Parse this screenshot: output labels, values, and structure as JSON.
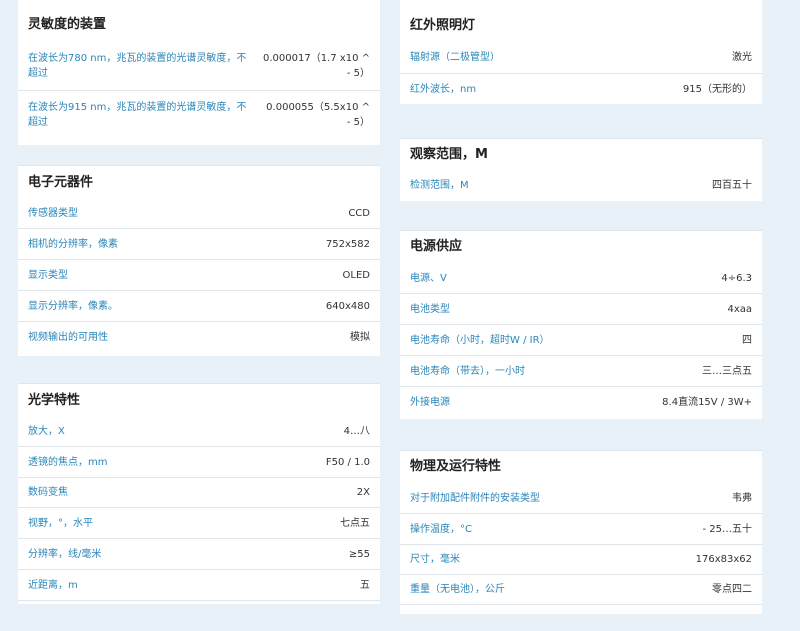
{
  "left": [
    {
      "title": "灵敏度的装置",
      "rows": [
        {
          "label": "在波长为780 nm，兆瓦的装置的光谱灵敏度，不超过",
          "value": "0.000017（1.7 x10 ^ - 5）"
        },
        {
          "label": "在波长为915 nm，兆瓦的装置的光谱灵敏度，不超过",
          "value": "0.000055（5.5x10 ^ - 5）"
        }
      ]
    },
    {
      "title": "电子元器件",
      "rows": [
        {
          "label": "传感器类型",
          "value": "CCD"
        },
        {
          "label": "相机的分辨率，像素",
          "value": "752x582"
        },
        {
          "label": "显示类型",
          "value": "OLED"
        },
        {
          "label": "显示分辨率，像素。",
          "value": "640x480"
        },
        {
          "label": "视频输出的可用性",
          "value": "模拟"
        }
      ]
    },
    {
      "title": "光学特性",
      "rows": [
        {
          "label": "放大，X",
          "value": "4…八"
        },
        {
          "label": "透镜的焦点，mm",
          "value": "F50 / 1.0"
        },
        {
          "label": "数码变焦",
          "value": "2X"
        },
        {
          "label": "视野，°，水平",
          "value": "七点五"
        },
        {
          "label": "分辨率，线/毫米",
          "value": "≥55"
        },
        {
          "label": "近距离，m",
          "value": "五"
        }
      ]
    }
  ],
  "right": [
    {
      "title": "红外照明灯",
      "rows": [
        {
          "label": "辐射源（二极管型）",
          "value": "激光"
        },
        {
          "label": "红外波长，nm",
          "value": "915（无形的）"
        }
      ]
    },
    {
      "title": "观察范围，M",
      "rows": [
        {
          "label": "检测范围，M",
          "value": "四百五十"
        }
      ]
    },
    {
      "title": "电源供应",
      "rows": [
        {
          "label": "电源、V",
          "value": "4÷6.3"
        },
        {
          "label": "电池类型",
          "value": "4xaa"
        },
        {
          "label": "电池寿命（小时，超时W / IR）",
          "value": "四"
        },
        {
          "label": "电池寿命（带去），一小时",
          "value": "三…三点五"
        },
        {
          "label": "外接电源",
          "value": "8.4直流15V / 3W+"
        }
      ]
    },
    {
      "title": "物理及运行特性",
      "rows": [
        {
          "label": "对于附加配件附件的安装类型",
          "value": "韦弗"
        },
        {
          "label": "操作温度，°C",
          "value": "- 25…五十"
        },
        {
          "label": "尺寸，毫米",
          "value": "176x83x62"
        },
        {
          "label": "重量（无电池），公斤",
          "value": "零点四二"
        }
      ]
    }
  ]
}
